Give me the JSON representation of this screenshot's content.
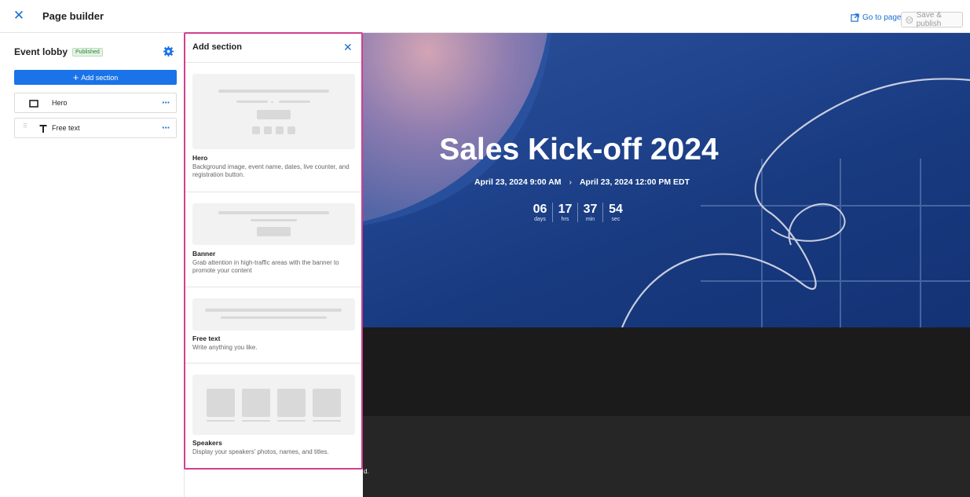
{
  "topbar": {
    "title": "Page builder",
    "goto_label": "Go to page",
    "save_label": "Save & publish"
  },
  "sidebar": {
    "page_name": "Event lobby",
    "status": "Published",
    "add_section_label": "Add section",
    "sections": [
      {
        "label": "Hero",
        "icon": "rectangle-icon"
      },
      {
        "label": "Free text",
        "icon": "text-t-icon"
      }
    ]
  },
  "panel": {
    "title": "Add section",
    "cards": [
      {
        "title": "Hero",
        "desc": "Background image, event name, dates, live counter, and registration button."
      },
      {
        "title": "Banner",
        "desc": "Grab attention in high-traffic areas with the banner to promote your content"
      },
      {
        "title": "Free text",
        "desc": "Write anything you like."
      },
      {
        "title": "Speakers",
        "desc": "Display your speakers' photos, names, and titles."
      }
    ]
  },
  "preview": {
    "hero_title": "Sales Kick-off 2024",
    "start": "April 23, 2024 9:00 AM",
    "arrow": "›",
    "end": "April 23, 2024 12:00 PM EDT",
    "counter": [
      {
        "n": "06",
        "u": "days"
      },
      {
        "n": "17",
        "u": "hrs"
      },
      {
        "n": "37",
        "u": "min"
      },
      {
        "n": "54",
        "u": "sec"
      }
    ],
    "fragment": "d."
  },
  "colors": {
    "accent": "#1a73e8",
    "highlight_border": "#d13f8f",
    "hero_bg": "#1d4189",
    "published_badge": "#2e7d32"
  }
}
